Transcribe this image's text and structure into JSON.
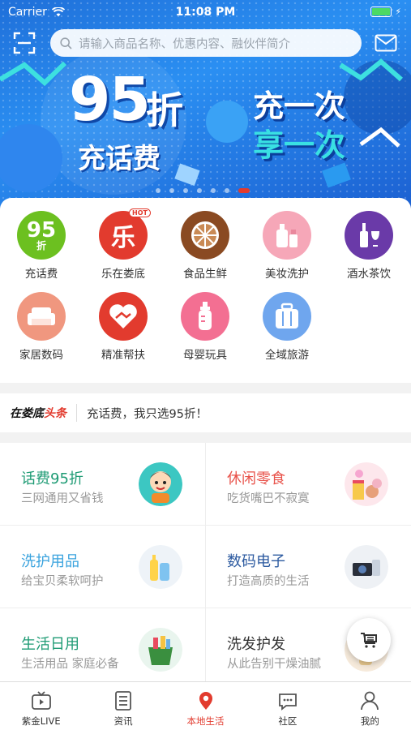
{
  "status_bar": {
    "carrier": "Carrier",
    "time": "11:08 PM"
  },
  "search": {
    "placeholder": "请输入商品名称、优惠内容、融伙伴简介"
  },
  "banner": {
    "big_number": "95",
    "big_unit": "折",
    "subtitle": "充话费",
    "right_line1": "充一次",
    "right_line2": "享一次",
    "page_count": 7,
    "active_page": 7
  },
  "categories": [
    {
      "label": "充话费",
      "icon": "discount-95-icon",
      "badge": "95",
      "badge2": "折",
      "color": "#6cc020"
    },
    {
      "label": "乐在娄底",
      "icon": "le-icon",
      "badge": "乐",
      "hot": "HOT",
      "color": "#e23b2e"
    },
    {
      "label": "食品生鲜",
      "icon": "orange-slice-icon",
      "color": "#8a4a22"
    },
    {
      "label": "美妆洗护",
      "icon": "cosmetics-icon",
      "color": "#f6a7b8"
    },
    {
      "label": "酒水茶饮",
      "icon": "wine-icon",
      "color": "#6a3aa8"
    },
    {
      "label": "家居数码",
      "icon": "sofa-icon",
      "color": "#f0977f"
    },
    {
      "label": "精准帮扶",
      "icon": "handshake-heart-icon",
      "color": "#e23b2e"
    },
    {
      "label": "母婴玩具",
      "icon": "baby-bottle-icon",
      "color": "#f36f92"
    },
    {
      "label": "全域旅游",
      "icon": "luggage-icon",
      "color": "#6fa6ee"
    }
  ],
  "headline": {
    "brand_a": "在娄底",
    "brand_b": "头条",
    "text": "充话费，我只选95折！"
  },
  "tiles": [
    {
      "title": "话费95折",
      "subtitle": "三网通用又省钱",
      "title_color": "#1e9b74",
      "icon": "boy-phone-icon"
    },
    {
      "title": "休闲零食",
      "subtitle": "吃货嘴巴不寂寞",
      "title_color": "#e8524a",
      "icon": "snacks-icon"
    },
    {
      "title": "洗护用品",
      "subtitle": "给宝贝柔软呵护",
      "title_color": "#3aa3de",
      "icon": "toiletries-icon"
    },
    {
      "title": "数码电子",
      "subtitle": "打造高质的生活",
      "title_color": "#2c5aa0",
      "icon": "camera-icon"
    },
    {
      "title": "生活日用",
      "subtitle": "生活用品 家庭必备",
      "title_color": "#1e9b74",
      "icon": "daily-goods-icon"
    },
    {
      "title": "洗发护发",
      "subtitle": "从此告别干燥油腻",
      "title_color": "#333333",
      "icon": "shampoo-icon"
    }
  ],
  "tabbar": [
    {
      "label": "紫金LIVE",
      "icon": "tv-icon",
      "active": false
    },
    {
      "label": "资讯",
      "icon": "news-icon",
      "active": false
    },
    {
      "label": "本地生活",
      "icon": "location-pin-icon",
      "active": true
    },
    {
      "label": "社区",
      "icon": "chat-icon",
      "active": false
    },
    {
      "label": "我的",
      "icon": "person-icon",
      "active": false
    }
  ],
  "colors": {
    "accent": "#e23b2e",
    "banner_blue": "#1f6fd9"
  }
}
